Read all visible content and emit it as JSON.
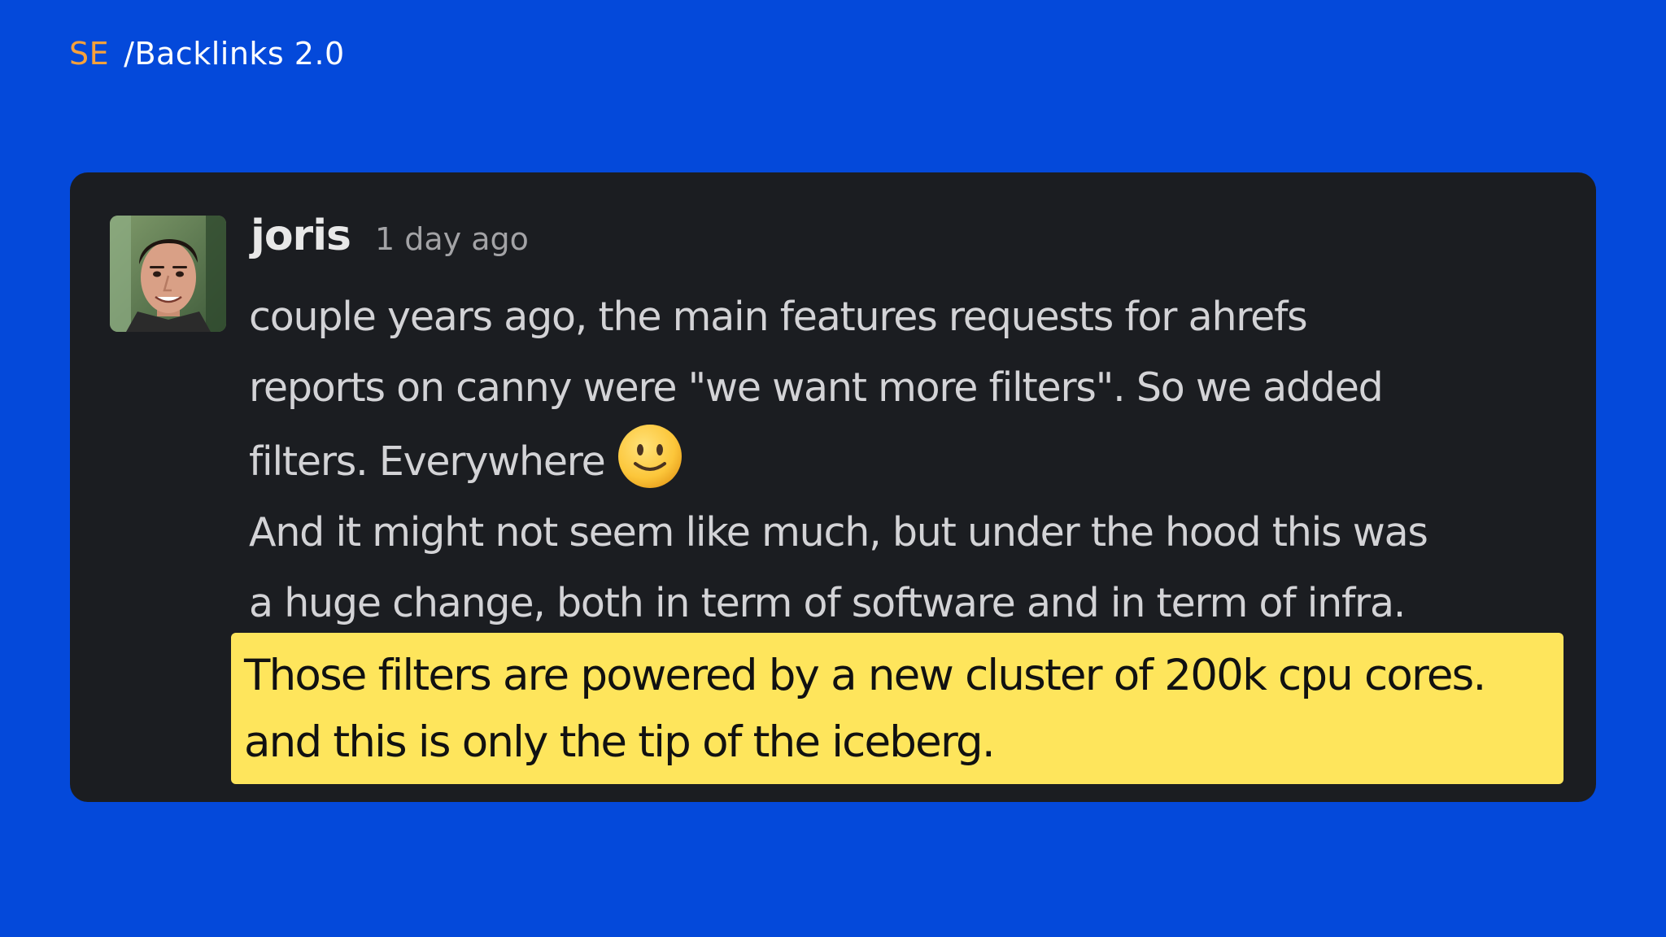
{
  "brand": {
    "prefix": "SE",
    "title": "/Backlinks 2.0",
    "prefix_color": "#F7A13B"
  },
  "colors": {
    "background": "#0449DA",
    "card": "#1B1D21",
    "highlight": "#FEE55C"
  },
  "message": {
    "author": "joris",
    "timestamp": "1 day ago",
    "avatar": "user-photo",
    "lines": [
      "couple years ago, the main features requests for ahrefs",
      "reports on canny were \"we want more filters\". So we added",
      "filters. Everywhere",
      "And it might not seem like much, but under the hood this was",
      "a huge change, both in term of software and in term of infra."
    ],
    "emoji": "slightly-smiling-face-icon",
    "highlighted_lines": [
      "Those filters are powered by a new cluster of 200k cpu cores.",
      "and this is only the tip of the iceberg."
    ]
  }
}
